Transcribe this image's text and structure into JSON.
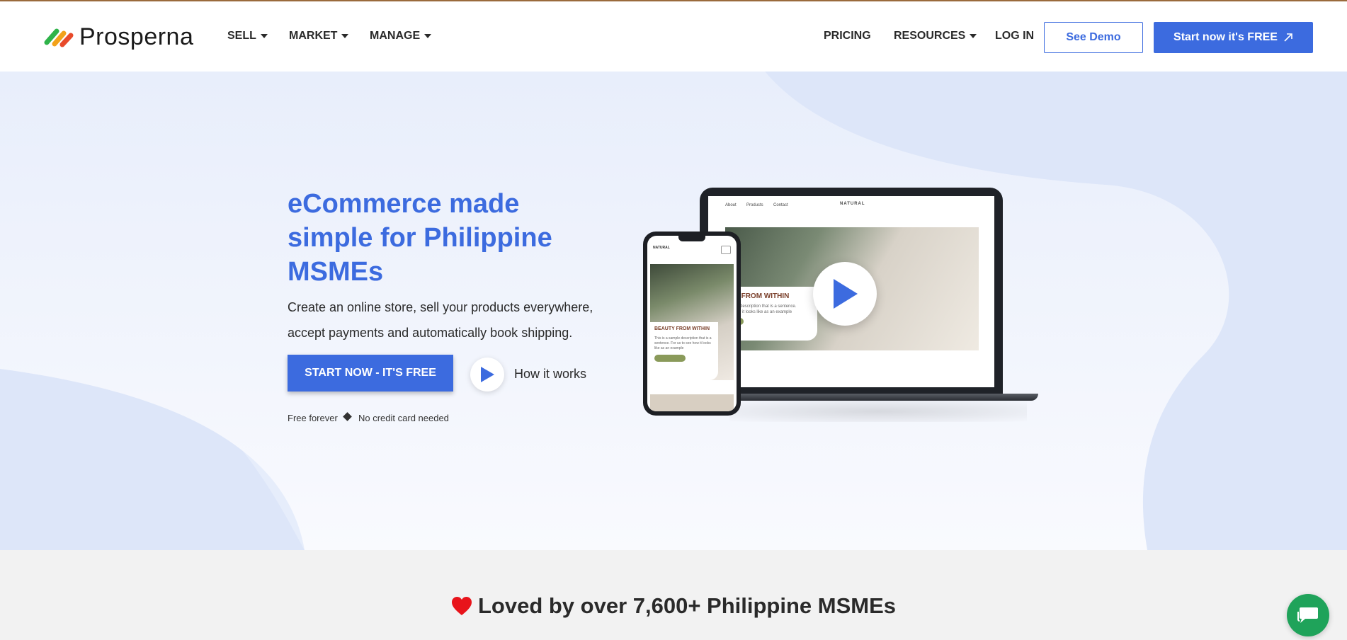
{
  "header": {
    "brand": "Prosperna",
    "nav_left": [
      {
        "label": "SELL",
        "has_caret": true
      },
      {
        "label": "MARKET",
        "has_caret": true
      },
      {
        "label": "MANAGE",
        "has_caret": true
      }
    ],
    "nav_right": [
      {
        "label": "PRICING",
        "has_caret": false
      },
      {
        "label": "RESOURCES",
        "has_caret": true
      },
      {
        "label": "LOG IN",
        "has_caret": false
      }
    ],
    "demo_button": "See Demo",
    "start_button": "Start now it's FREE"
  },
  "hero": {
    "title": "eCommerce made simple for Philippine MSMEs",
    "subtitle": "Create an online store, sell your products everywhere, accept payments and automatically book shipping.",
    "cta_button": "START NOW - IT'S FREE",
    "how_it_works": "How it works",
    "note_free": "Free forever",
    "note_card": "No credit card needed"
  },
  "mockup": {
    "laptop_nav": [
      "About",
      "Products",
      "Contact"
    ],
    "store_brand": "NATURAL",
    "laptop_heading": "UTY FROM WITHIN",
    "laptop_desc": "sample description that is a sentence. see how it looks like as an example",
    "phone_heading": "BEAUTY FROM WITHIN",
    "phone_desc": "This is a sample description that is a sentence. For us to see how it looks like as an example",
    "phone_button": "Order Now"
  },
  "loved": {
    "title": "Loved by over 7,600+ Philippine MSMEs"
  },
  "colors": {
    "brand_blue": "#3c6bdf",
    "hero_bg": "#e8eefb",
    "chat_green": "#1fa35a",
    "heart_red": "#e8141b"
  },
  "icons": {
    "logo": "prosperna-logo-icon",
    "play": "play-icon",
    "external": "external-link-icon",
    "chat": "chat-icon",
    "heart": "heart-icon"
  }
}
